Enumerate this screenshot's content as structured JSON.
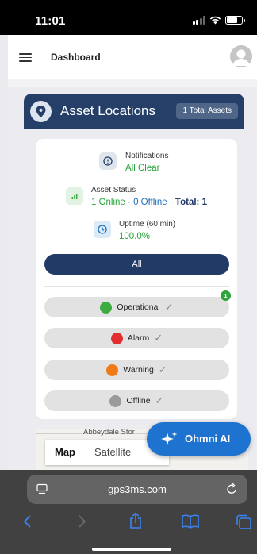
{
  "status_bar": {
    "time": "11:01"
  },
  "app_header": {
    "title": "Dashboard"
  },
  "asset_card": {
    "title": "Asset Locations",
    "total_badge": "1 Total Assets"
  },
  "stats": {
    "notifications": {
      "label": "Notifications",
      "value": "All Clear"
    },
    "asset_status": {
      "label": "Asset Status",
      "online": "1 Online",
      "offline": "· 0 Offline ·",
      "total": "Total: 1"
    },
    "uptime": {
      "label": "Uptime (60 min)",
      "value": "100.0%"
    }
  },
  "filters": {
    "all_label": "All",
    "items": [
      {
        "label": "Operational",
        "color": "#3dab3f",
        "count": "1"
      },
      {
        "label": "Alarm",
        "color": "#e12f2f"
      },
      {
        "label": "Warning",
        "color": "#f07a18"
      },
      {
        "label": "Offline",
        "color": "#9a9a9a"
      }
    ]
  },
  "map": {
    "street": "Abbeydale Stor",
    "tabs": [
      "Map",
      "Satellite"
    ]
  },
  "assistant": {
    "label": "Ohmni AI"
  },
  "browser": {
    "url": "gps3ms.com"
  },
  "colors": {
    "header_navy": "#253f69",
    "primary": "#213a66",
    "accent_blue": "#1f73d0",
    "success": "#27a33a"
  }
}
